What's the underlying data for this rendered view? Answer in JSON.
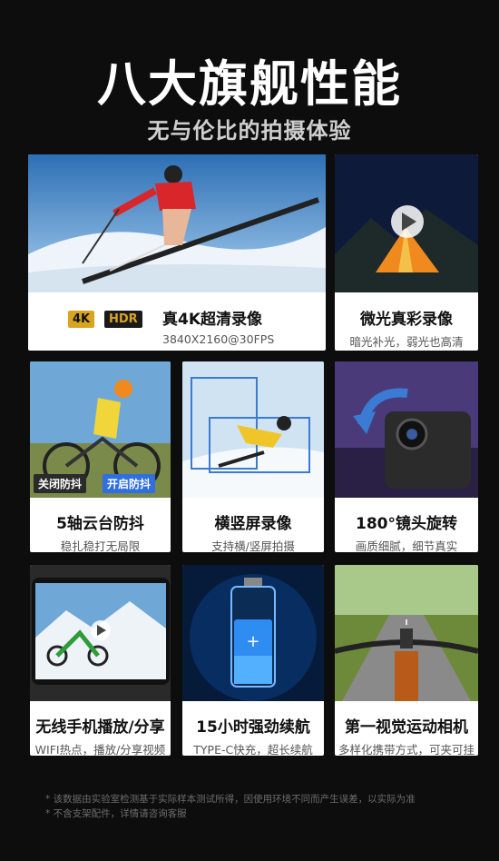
{
  "header": {
    "title": "八大旗舰性能",
    "subtitle": "无与伦比的拍摄体验"
  },
  "features": [
    {
      "title": "真4K超清录像",
      "sub": "3840X2160@30FPS",
      "badge_4k": "4K",
      "badge_hdr": "HDR"
    },
    {
      "title": "微光真彩录像",
      "sub": "暗光补光，弱光也高清"
    },
    {
      "title": "5轴云台防抖",
      "sub": "稳扎稳打无局限",
      "tag_off": "关闭防抖",
      "tag_on": "开启防抖"
    },
    {
      "title": "横竖屏录像",
      "sub": "支持横/竖屏拍摄"
    },
    {
      "title": "180°镜头旋转",
      "sub": "画质细腻，细节真实"
    },
    {
      "title": "无线手机播放/分享",
      "sub": "WIFI热点，播放/分享视频"
    },
    {
      "title": "15小时强劲续航",
      "sub": "TYPE-C快充，超长续航"
    },
    {
      "title": "第一视觉运动相机",
      "sub": "多样化携带方式，可夹可挂"
    }
  ],
  "footer": {
    "note1": "* 该数据由实验室检测基于实际样本测试所得，因使用环境不同而产生误差，以实际为准",
    "note2": "* 不含支架配件，详情请咨询客服"
  },
  "colors": {
    "background": "#0d0d0d",
    "card": "#ffffff",
    "tag_on": "#2f6fe0",
    "tag_off": "#2a2a2a",
    "hdr_gold": "#d9a520"
  }
}
